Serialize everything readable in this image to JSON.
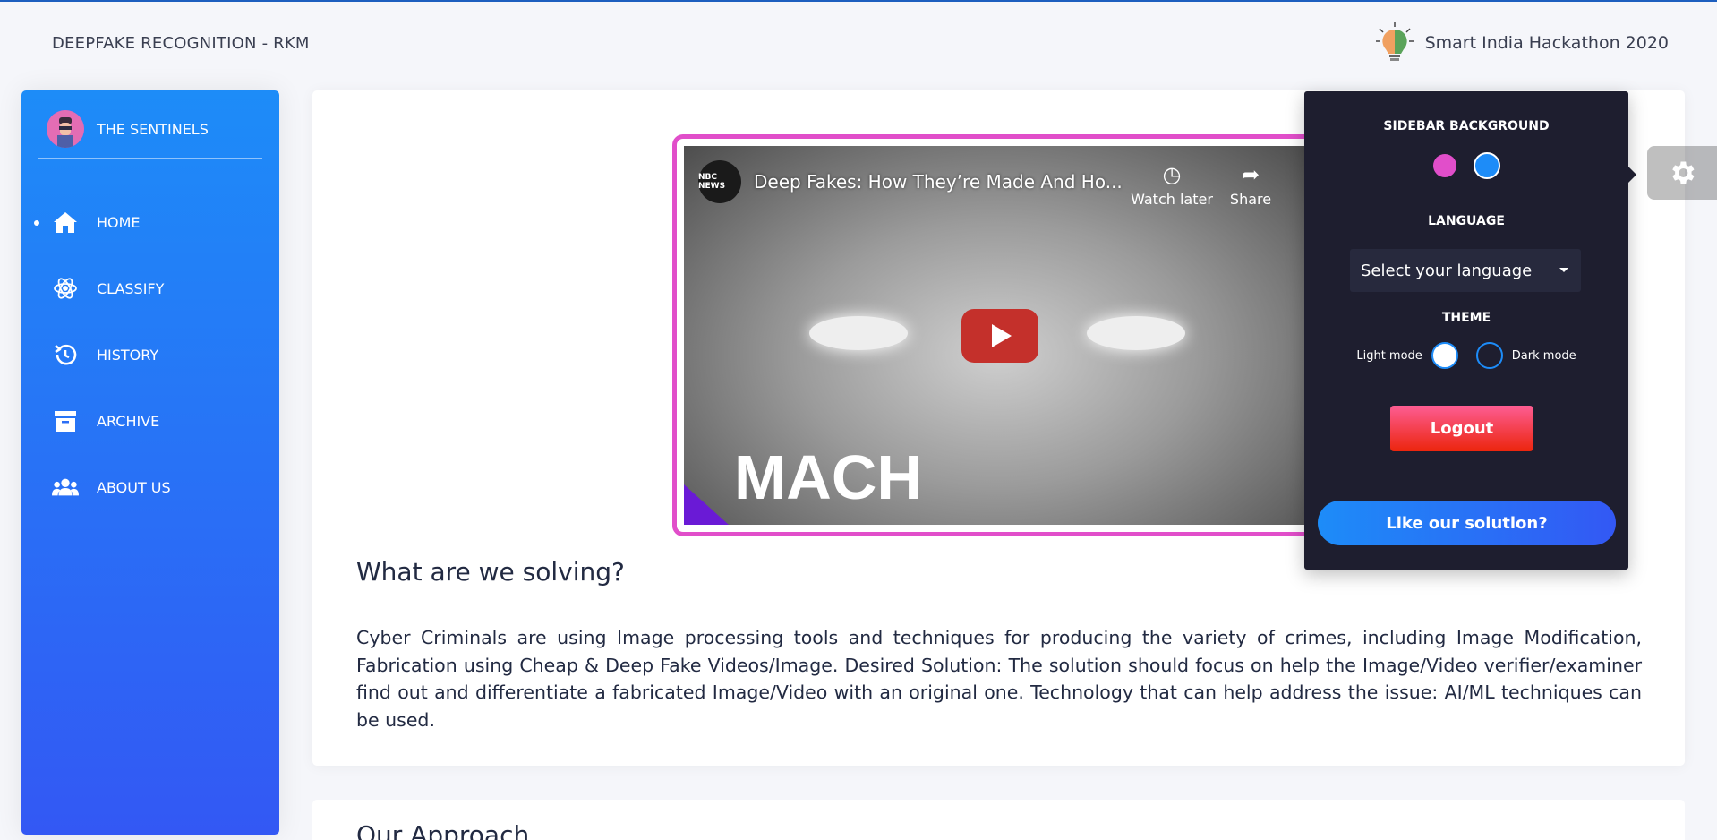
{
  "header": {
    "brand": "DEEPFAKE RECOGNITION - RKM",
    "hackathon": "Smart India Hackathon 2020"
  },
  "sidebar": {
    "team_name": "THE SENTINELS",
    "items": [
      {
        "label": "HOME",
        "icon": "home-icon",
        "active": true
      },
      {
        "label": "CLASSIFY",
        "icon": "atom-icon"
      },
      {
        "label": "HISTORY",
        "icon": "history-icon"
      },
      {
        "label": "ARCHIVE",
        "icon": "archive-icon"
      },
      {
        "label": "ABOUT US",
        "icon": "users-icon"
      }
    ]
  },
  "video": {
    "channel": "NBC NEWS",
    "title": "Deep Fakes: How They’re Made And Ho...",
    "watch_later": "Watch later",
    "share": "Share",
    "overlay_text": "MACH"
  },
  "main": {
    "heading": "What are we solving?",
    "paragraph": "Cyber Criminals are using Image processing tools and techniques for producing the variety of crimes, including Image Modification, Fabrication using Cheap & Deep Fake Videos/Image. Desired Solution: The solution should focus on help the Image/Video verifier/examiner find out and differentiate a fabricated Image/Video with an original one. Technology that can help address the issue: AI/ML techniques can be used.",
    "next_heading": "Our Approach"
  },
  "settings": {
    "sidebar_bg_heading": "SIDEBAR BACKGROUND",
    "sidebar_colors": [
      "#e14eca",
      "#1d8cf8"
    ],
    "language_heading": "LANGUAGE",
    "language_select": "Select your language",
    "theme_heading": "THEME",
    "light_mode": "Light mode",
    "dark_mode": "Dark mode",
    "logout": "Logout",
    "like": "Like our solution?"
  },
  "colors": {
    "primary": "#1d8cf8",
    "secondary": "#3358f4",
    "accent": "#e14eca",
    "danger": "#ec250d",
    "panel": "#1e1e2f"
  }
}
